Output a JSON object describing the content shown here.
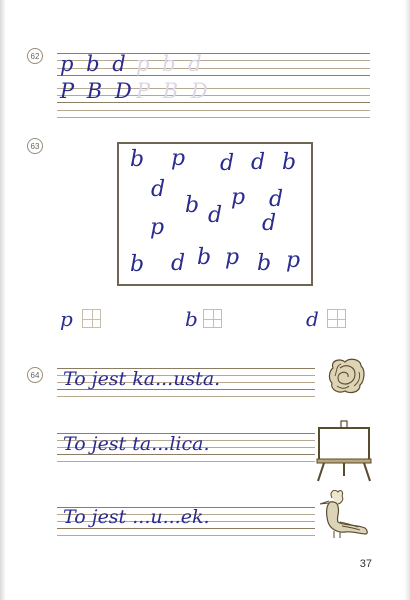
{
  "exercise_62": {
    "number": "62",
    "row1_letters": "p b d",
    "row1_ghost": "p b d",
    "row2_letters": "P B D",
    "row2_ghost": "P B D"
  },
  "exercise_63": {
    "number": "63",
    "box_letters": [
      "b",
      "p",
      "d",
      "d",
      "b",
      "d",
      "b",
      "p",
      "d",
      "p",
      "d",
      "d",
      "b",
      "d",
      "b",
      "p",
      "b",
      "p"
    ],
    "answers": [
      {
        "letter": "p"
      },
      {
        "letter": "b"
      },
      {
        "letter": "d"
      }
    ]
  },
  "exercise_64": {
    "number": "64",
    "sentences": [
      "To jest ka...usta.",
      "To jest ta...lica.",
      "To jest ...u...ek."
    ],
    "picture_icons": [
      "cabbage-icon",
      "easel-board-icon",
      "hoopoe-bird-icon"
    ]
  },
  "page": {
    "number": "37"
  }
}
